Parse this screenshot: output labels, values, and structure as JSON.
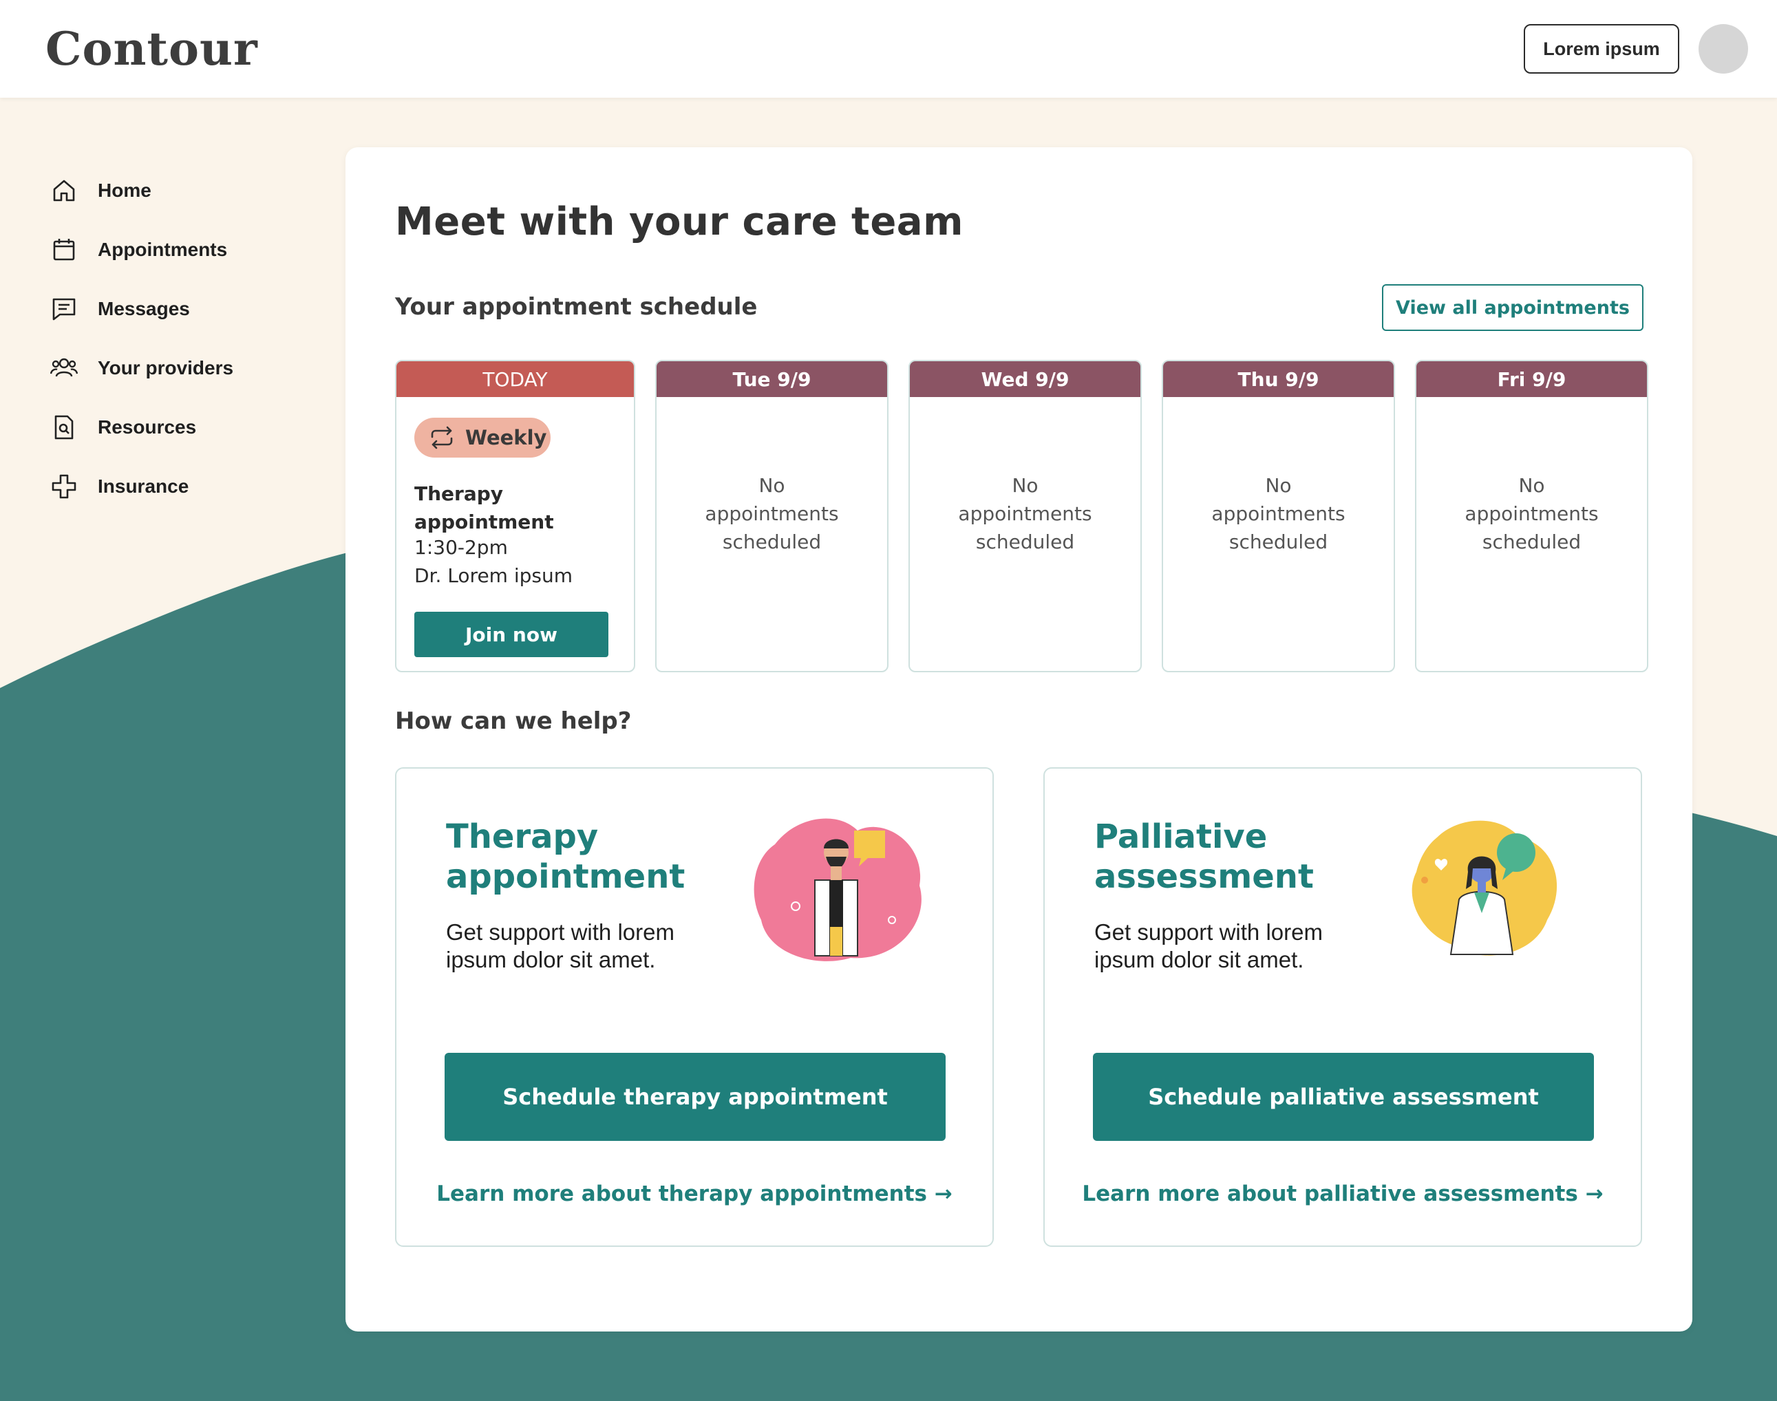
{
  "brand": {
    "logo": "Contour"
  },
  "header": {
    "button_label": "Lorem ipsum"
  },
  "sidebar": {
    "items": [
      {
        "label": "Home",
        "icon": "home-icon"
      },
      {
        "label": "Appointments",
        "icon": "calendar-icon"
      },
      {
        "label": "Messages",
        "icon": "message-icon"
      },
      {
        "label": "Your providers",
        "icon": "people-icon"
      },
      {
        "label": "Resources",
        "icon": "document-search-icon"
      },
      {
        "label": "Insurance",
        "icon": "medical-cross-icon"
      }
    ]
  },
  "main": {
    "title": "Meet with your care team",
    "schedule": {
      "heading": "Your appointment schedule",
      "view_all_label": "View all appointments",
      "today": {
        "label": "TODAY",
        "badge": "Weekly",
        "title_line1": "Therapy",
        "title_line2": "appointment",
        "time": "1:30-2pm",
        "provider": "Dr. Lorem ipsum",
        "join_label": "Join now"
      },
      "days": [
        {
          "label": "Tue 9/9",
          "line1": "No",
          "line2": "appointments",
          "line3": "scheduled"
        },
        {
          "label": "Wed  9/9",
          "line1": "No",
          "line2": "appointments",
          "line3": "scheduled"
        },
        {
          "label": "Thu  9/9",
          "line1": "No",
          "line2": "appointments",
          "line3": "scheduled"
        },
        {
          "label": "Fri  9/9",
          "line1": "No",
          "line2": "appointments",
          "line3": "scheduled"
        }
      ]
    },
    "help": {
      "heading": "How can we help?",
      "cards": [
        {
          "title_line1": "Therapy",
          "title_line2": "appointment",
          "desc_line1": "Get support with lorem",
          "desc_line2": "ipsum dolor sit amet.",
          "button_label": "Schedule therapy appointment",
          "link_label": "Learn more about therapy appointments →"
        },
        {
          "title_line1": "Palliative",
          "title_line2": "assessment",
          "desc_line1": "Get support with lorem",
          "desc_line2": "ipsum dolor sit amet.",
          "button_label": "Schedule palliative assessment",
          "link_label": "Learn more about palliative assessments →"
        }
      ]
    }
  },
  "colors": {
    "accent": "#1f7f7b",
    "today_header": "#c45b55",
    "day_header": "#8b5464",
    "background": "#fbf4ea",
    "wave": "#3f7f7b",
    "badge": "#efb3a1"
  }
}
